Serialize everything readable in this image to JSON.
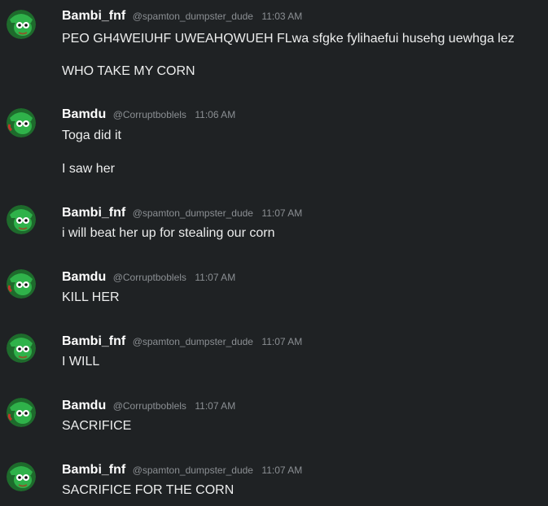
{
  "messages": [
    {
      "username": "Bambi_fnf",
      "handle": "@spamton_dumpster_dude",
      "time": "11:03 AM",
      "avatar_icon": "green-character-avatar-icon",
      "lines": [
        "PEO GH4WEIUHF UWEAHQWUEH FLwa sfgke  fylihaefui husehg uewhga lez",
        "WHO TAKE MY CORN"
      ]
    },
    {
      "username": "Bamdu",
      "handle": "@Corruptboblels",
      "time": "11:06 AM",
      "avatar_icon": "green-character-avatar-icon",
      "lines": [
        "Toga did it",
        "I saw her"
      ]
    },
    {
      "username": "Bambi_fnf",
      "handle": "@spamton_dumpster_dude",
      "time": "11:07 AM",
      "avatar_icon": "green-character-avatar-icon",
      "lines": [
        "i will beat her up for stealing our corn"
      ]
    },
    {
      "username": "Bamdu",
      "handle": "@Corruptboblels",
      "time": "11:07 AM",
      "avatar_icon": "green-character-avatar-icon",
      "lines": [
        "KILL HER"
      ]
    },
    {
      "username": "Bambi_fnf",
      "handle": "@spamton_dumpster_dude",
      "time": "11:07 AM",
      "avatar_icon": "green-character-avatar-icon",
      "lines": [
        "I WILL"
      ]
    },
    {
      "username": "Bamdu",
      "handle": "@Corruptboblels",
      "time": "11:07 AM",
      "avatar_icon": "green-character-avatar-icon",
      "lines": [
        "SACRIFICE"
      ]
    },
    {
      "username": "Bambi_fnf",
      "handle": "@spamton_dumpster_dude",
      "time": "11:07 AM",
      "avatar_icon": "green-character-avatar-icon",
      "lines": [
        "SACRIFICE FOR THE CORN"
      ]
    }
  ],
  "colors": {
    "background": "#1f2224",
    "username": "#ffffff",
    "meta": "#8b8f93",
    "text": "#eceded",
    "avatar_green": "#2fb24a"
  }
}
